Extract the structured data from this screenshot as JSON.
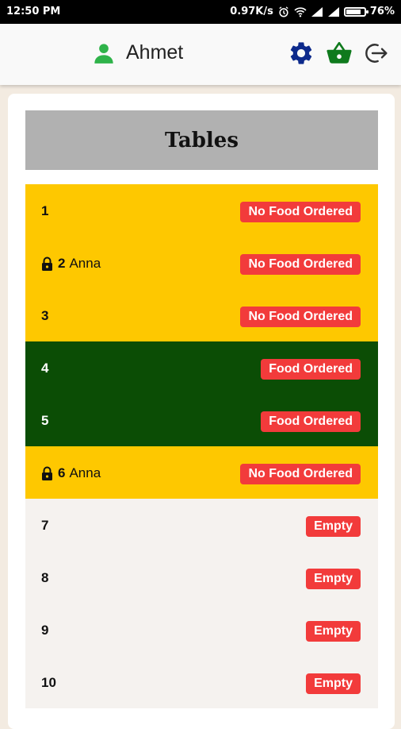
{
  "status_bar": {
    "time": "12:50 PM",
    "speed": "0.97K/s",
    "battery": "76%"
  },
  "header": {
    "user_name": "Ahmet"
  },
  "page": {
    "title": "Tables"
  },
  "colors": {
    "yellow": "#fec800",
    "green": "#0b4d05",
    "empty": "#f5f2ef",
    "badge": "#f23b3b"
  },
  "tables": [
    {
      "number": "1",
      "guest": "",
      "locked": false,
      "status": "No Food Ordered",
      "color": "yellow"
    },
    {
      "number": "2",
      "guest": "Anna",
      "locked": true,
      "status": "No Food Ordered",
      "color": "yellow"
    },
    {
      "number": "3",
      "guest": "",
      "locked": false,
      "status": "No Food Ordered",
      "color": "yellow"
    },
    {
      "number": "4",
      "guest": "",
      "locked": false,
      "status": "Food Ordered",
      "color": "green"
    },
    {
      "number": "5",
      "guest": "",
      "locked": false,
      "status": "Food Ordered",
      "color": "green"
    },
    {
      "number": "6",
      "guest": "Anna",
      "locked": true,
      "status": "No Food Ordered",
      "color": "yellow"
    },
    {
      "number": "7",
      "guest": "",
      "locked": false,
      "status": "Empty",
      "color": "empty"
    },
    {
      "number": "8",
      "guest": "",
      "locked": false,
      "status": "Empty",
      "color": "empty"
    },
    {
      "number": "9",
      "guest": "",
      "locked": false,
      "status": "Empty",
      "color": "empty"
    },
    {
      "number": "10",
      "guest": "",
      "locked": false,
      "status": "Empty",
      "color": "empty"
    }
  ]
}
